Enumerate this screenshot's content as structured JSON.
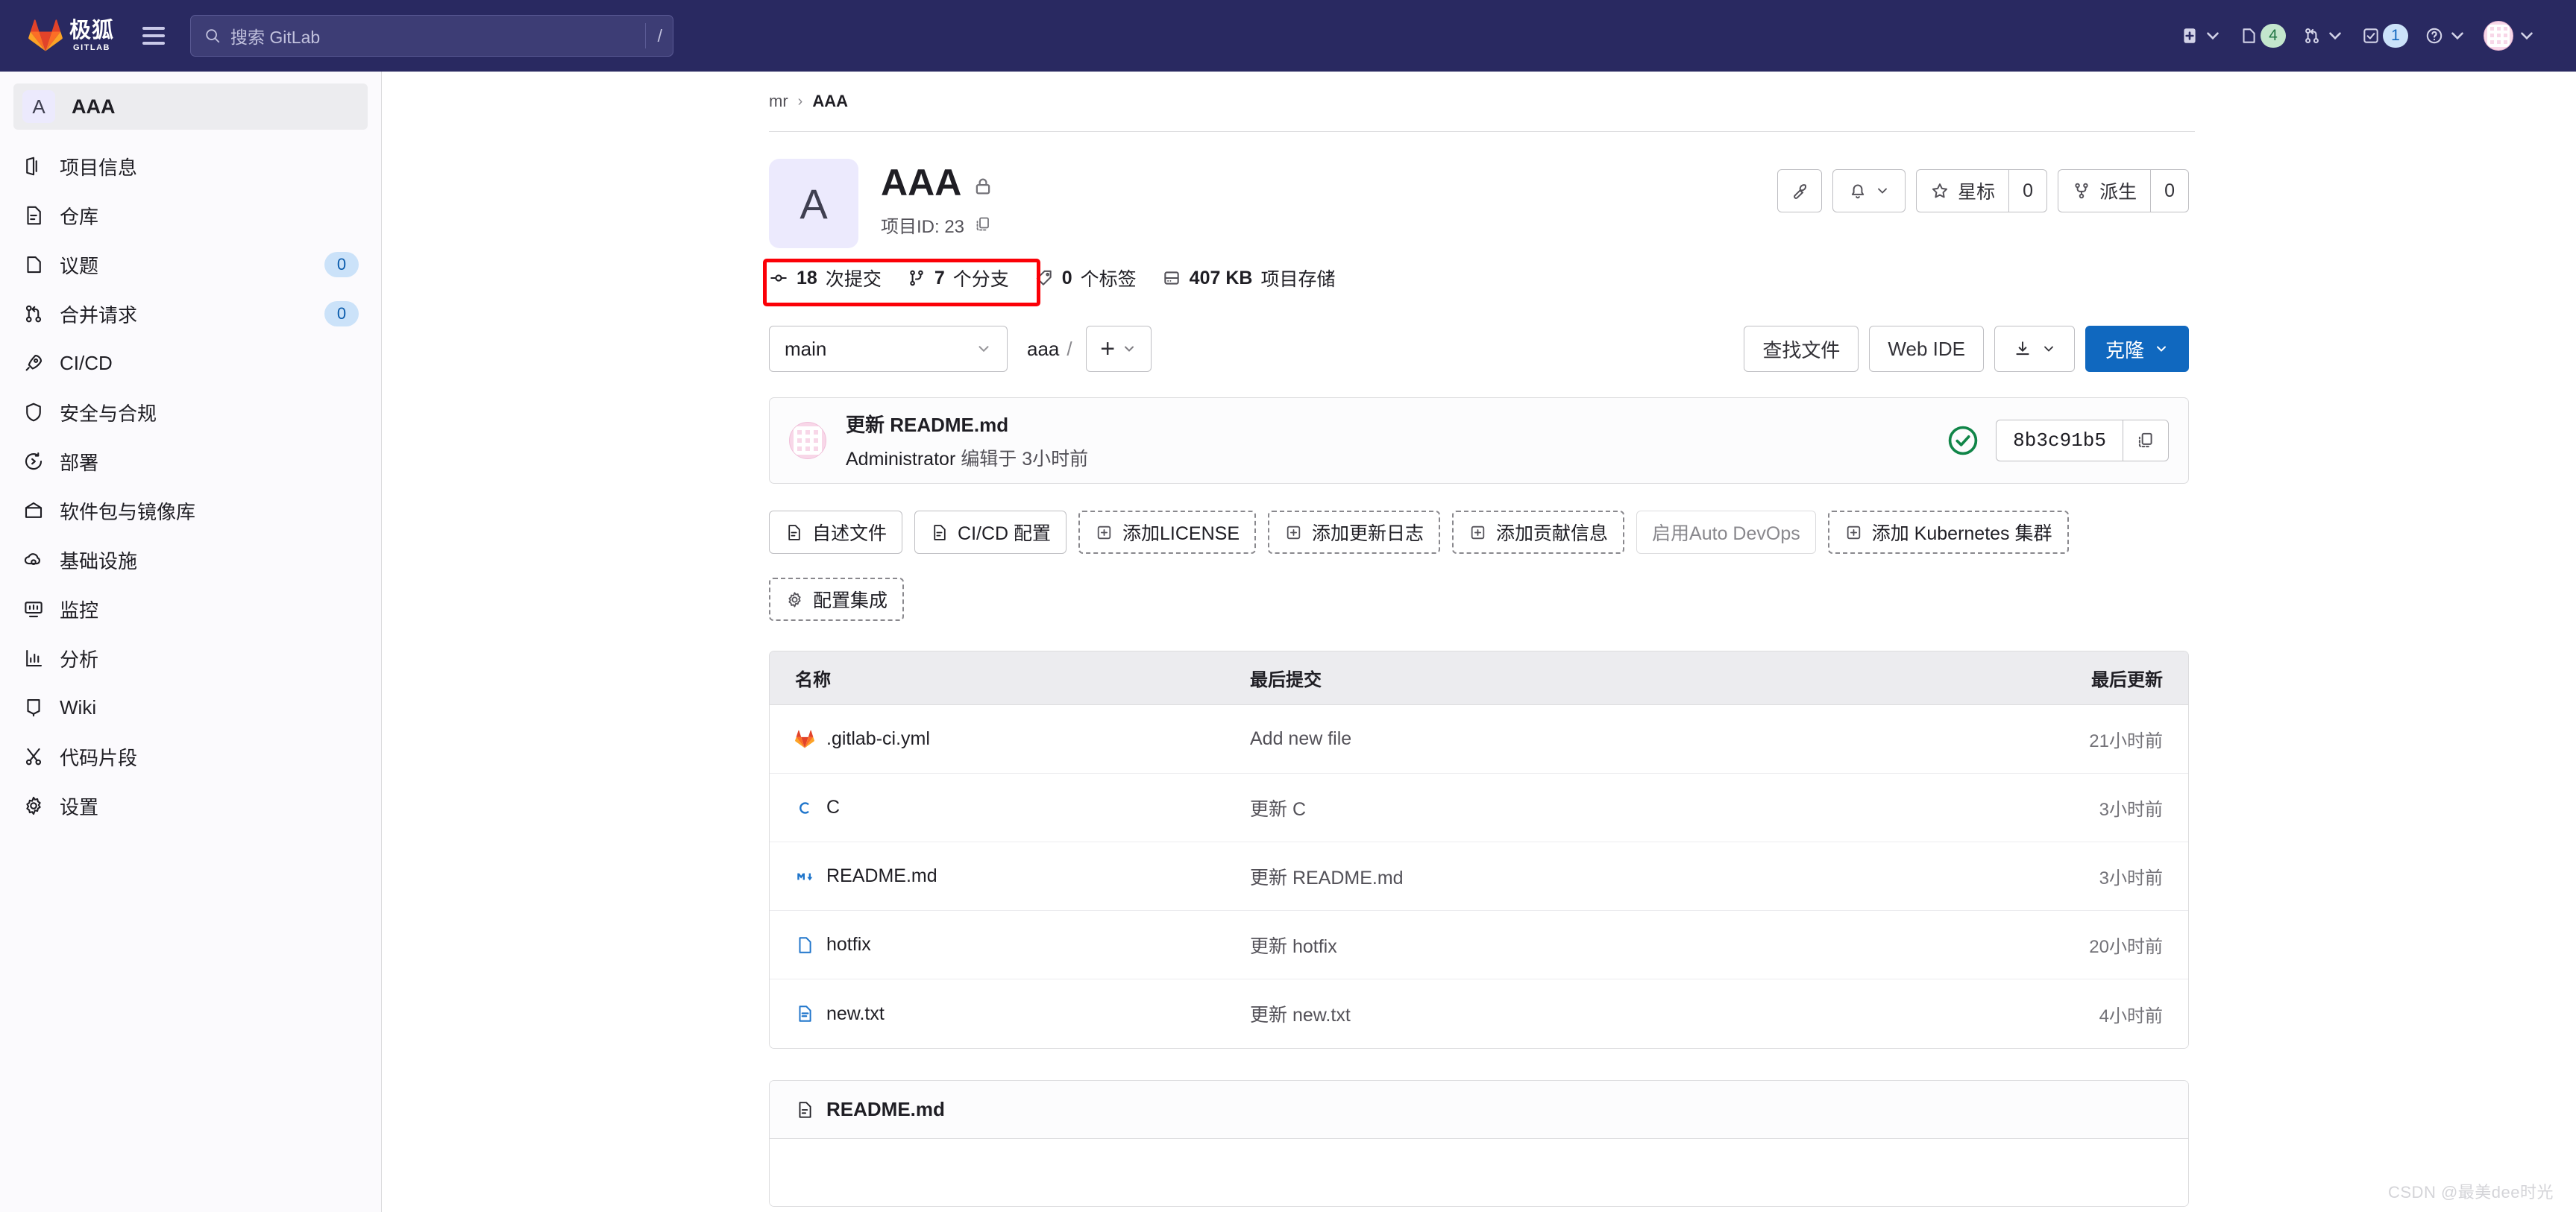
{
  "navbar": {
    "brand_cn": "极狐",
    "brand_sub": "GITLAB",
    "menu_icon": "hamburger-icon",
    "search": {
      "placeholder": "搜索 GitLab",
      "value": "",
      "shortcut": "/",
      "icon": "search-icon"
    },
    "items": [
      {
        "name": "create-new",
        "icon": "plus-square-icon",
        "badge": null
      },
      {
        "name": "issues",
        "icon": "issues-icon",
        "badge": "4",
        "badge_color": "#c3e6cd"
      },
      {
        "name": "merge-requests",
        "icon": "merge-request-icon",
        "badge": null
      },
      {
        "name": "todos",
        "icon": "todo-check-icon",
        "badge": "1",
        "badge_color": "#cbe2f9"
      },
      {
        "name": "help",
        "icon": "question-circle-icon",
        "badge": null
      },
      {
        "name": "user-menu",
        "icon": "avatar",
        "badge": null
      }
    ],
    "bg": "#292961"
  },
  "sidebar": {
    "project": {
      "initial": "A",
      "name": "AAA"
    },
    "items": [
      {
        "label": "项目信息",
        "icon": "project-info-icon",
        "count": null
      },
      {
        "label": "仓库",
        "icon": "repository-doc-icon",
        "count": null
      },
      {
        "label": "议题",
        "icon": "issue-icon",
        "count": "0"
      },
      {
        "label": "合并请求",
        "icon": "merge-request-icon",
        "count": "0"
      },
      {
        "label": "CI/CD",
        "icon": "rocket-icon",
        "count": null
      },
      {
        "label": "安全与合规",
        "icon": "shield-icon",
        "count": null
      },
      {
        "label": "部署",
        "icon": "deploy-icon",
        "count": null
      },
      {
        "label": "软件包与镜像库",
        "icon": "package-icon",
        "count": null
      },
      {
        "label": "基础设施",
        "icon": "infrastructure-cloud-icon",
        "count": null
      },
      {
        "label": "监控",
        "icon": "monitor-icon",
        "count": null
      },
      {
        "label": "分析",
        "icon": "analytics-chart-icon",
        "count": null
      },
      {
        "label": "Wiki",
        "icon": "book-icon",
        "count": null
      },
      {
        "label": "代码片段",
        "icon": "scissors-icon",
        "count": null
      },
      {
        "label": "设置",
        "icon": "gear-icon",
        "count": null
      }
    ]
  },
  "breadcrumb": {
    "group": "mr",
    "separator": "›",
    "project": "AAA"
  },
  "project": {
    "initial": "A",
    "title": "AAA",
    "visibility_icon": "lock-icon",
    "id_label": "项目ID: 23",
    "copy_icon": "copy-icon",
    "actions": {
      "settings_icon": "wrench-icon",
      "notify_icon": "bell-icon",
      "star_label": "星标",
      "star_count": "0",
      "fork_label": "派生",
      "fork_count": "0"
    },
    "stats": [
      {
        "label_num": "18",
        "label_txt": "次提交",
        "icon": "commit-icon",
        "highlighted": true
      },
      {
        "label_num": "7",
        "label_txt": "个分支",
        "icon": "branch-icon",
        "highlighted": true
      },
      {
        "label_num": "0",
        "label_txt": "个标签",
        "icon": "tag-icon",
        "highlighted": false
      },
      {
        "label_num": "407 KB",
        "label_txt": "项目存储",
        "icon": "storage-icon",
        "highlighted": false
      }
    ],
    "highlight_color": "#fb0007"
  },
  "repo_bar": {
    "branch": "main",
    "path_root": "aaa",
    "path_sep": "/",
    "add_icon": "plus-icon",
    "find_file": "查找文件",
    "web_ide": "Web IDE",
    "download_icon": "download-icon",
    "clone": "克隆",
    "primary_color": "#1068bf"
  },
  "last_commit": {
    "message": "更新 README.md",
    "author": "Administrator",
    "action": "编辑于",
    "time": "3小时前",
    "pipeline_status": "success",
    "sha": "8b3c91b5",
    "copy_icon": "copy-icon"
  },
  "quick_actions": [
    {
      "label": "自述文件",
      "icon": "doc-icon",
      "style": "solid"
    },
    {
      "label": "CI/CD 配置",
      "icon": "doc-icon",
      "style": "solid"
    },
    {
      "label": "添加LICENSE",
      "icon": "plus-box-icon",
      "style": "dashed"
    },
    {
      "label": "添加更新日志",
      "icon": "plus-box-icon",
      "style": "dashed"
    },
    {
      "label": "添加贡献信息",
      "icon": "plus-box-icon",
      "style": "dashed"
    },
    {
      "label": "启用Auto DevOps",
      "icon": null,
      "style": "muted"
    },
    {
      "label": "添加 Kubernetes 集群",
      "icon": "plus-box-icon",
      "style": "dashed"
    },
    {
      "label": "配置集成",
      "icon": "gear-icon",
      "style": "dashed"
    }
  ],
  "file_table": {
    "columns": {
      "name": "名称",
      "commit": "最后提交",
      "updated": "最后更新"
    },
    "rows": [
      {
        "name": ".gitlab-ci.yml",
        "icon": "gitlab-fox-icon",
        "commit": "Add new file",
        "updated": "21小时前"
      },
      {
        "name": "C",
        "icon": "c-file-icon",
        "commit": "更新 C",
        "updated": "3小时前"
      },
      {
        "name": "README.md",
        "icon": "markdown-icon",
        "commit": "更新 README.md",
        "updated": "3小时前"
      },
      {
        "name": "hotfix",
        "icon": "file-icon",
        "commit": "更新 hotfix",
        "updated": "20小时前"
      },
      {
        "name": "new.txt",
        "icon": "text-file-icon",
        "commit": "更新 new.txt",
        "updated": "4小时前"
      }
    ]
  },
  "readme": {
    "title": "README.md",
    "icon": "doc-icon"
  },
  "watermark": "CSDN @最美dee时光"
}
